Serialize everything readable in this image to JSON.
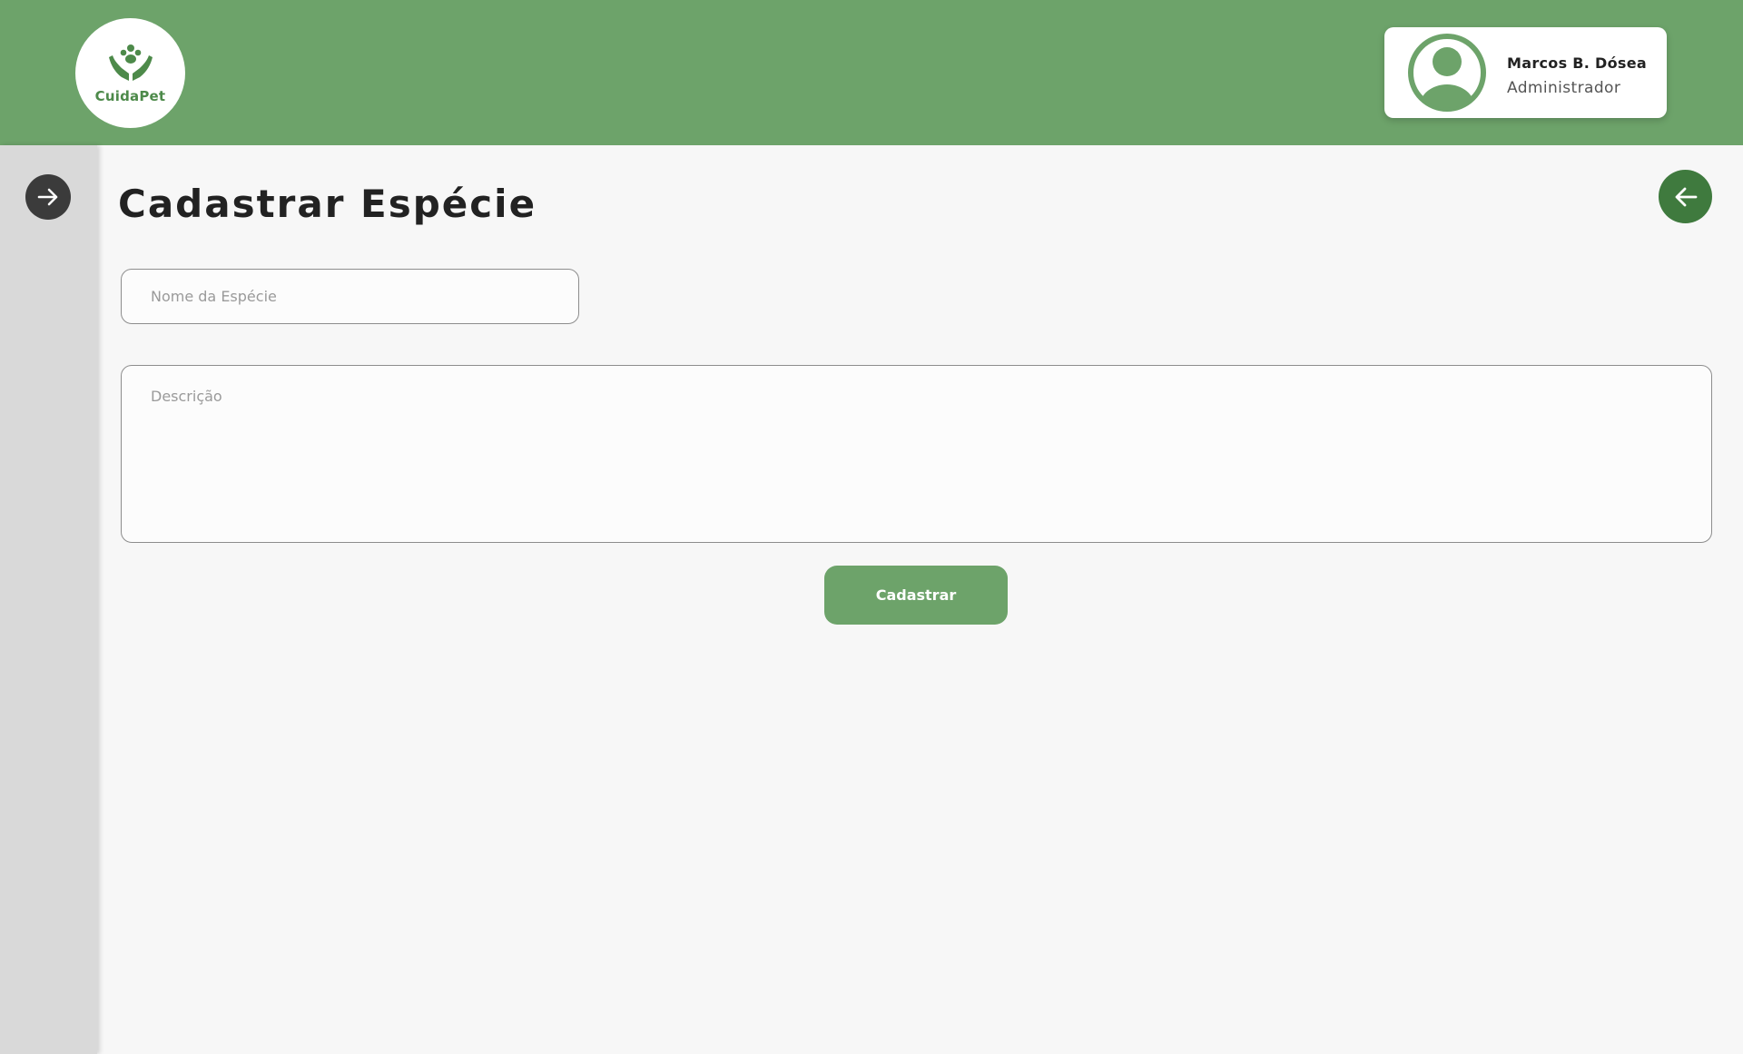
{
  "header": {
    "logo_text": "CuidaPet",
    "user": {
      "name": "Marcos B. Dósea",
      "role": "Administrador"
    }
  },
  "sidebar": {
    "toggle_icon": "arrow-right-icon"
  },
  "main": {
    "title": "Cadastrar Espécie",
    "back_icon": "arrow-left-icon",
    "form": {
      "name_placeholder": "Nome da Espécie",
      "name_value": "",
      "description_placeholder": "Descrição",
      "description_value": "",
      "submit_label": "Cadastrar"
    }
  },
  "colors": {
    "brand_green": "#6da36a",
    "dark_green": "#3f7a3e",
    "sidebar_gray": "#d9d9d9",
    "background": "#f7f7f7"
  }
}
